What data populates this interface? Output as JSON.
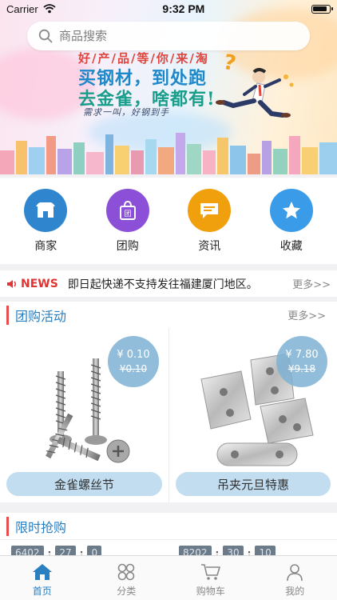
{
  "status": {
    "carrier": "Carrier",
    "time": "9:32 PM"
  },
  "search": {
    "placeholder": "商品搜索"
  },
  "banner": {
    "tagline_top": "好/产/品/等/你/来/淘",
    "line1": "买钢材，到处跑",
    "line2": "去金雀，啥都有!",
    "line3": "需求一叫，好钢到手"
  },
  "quick_nav": [
    {
      "label": "商家",
      "icon": "shop-icon",
      "color": "#2f86cf"
    },
    {
      "label": "团购",
      "icon": "shopping-bag-icon",
      "color": "#8b4fd8"
    },
    {
      "label": "资讯",
      "icon": "message-icon",
      "color": "#f0a00d"
    },
    {
      "label": "收藏",
      "icon": "star-icon",
      "color": "#3a9be8"
    }
  ],
  "news": {
    "title": "NEWS",
    "text": "即日起快递不支持发往福建厦门地区。",
    "more": "更多>>"
  },
  "group_buy": {
    "title": "团购活动",
    "more": "更多>>",
    "products": [
      {
        "price": "¥ 0.10",
        "old_price": "¥0.10",
        "name": "金雀螺丝节"
      },
      {
        "price": "¥ 7.80",
        "old_price": "¥9.18",
        "name": "吊夹元旦特惠"
      }
    ]
  },
  "flash_sale": {
    "title": "限时抢购",
    "timers": [
      [
        "6402",
        "27",
        "0"
      ],
      [
        "8202",
        "30",
        "10"
      ]
    ]
  },
  "tabbar": [
    {
      "label": "首页",
      "icon": "home-icon",
      "active": true
    },
    {
      "label": "分类",
      "icon": "category-icon",
      "active": false
    },
    {
      "label": "购物车",
      "icon": "cart-icon",
      "active": false
    },
    {
      "label": "我的",
      "icon": "profile-icon",
      "active": false
    }
  ],
  "colors": {
    "accent": "#2a7fc0",
    "news_red": "#e03434",
    "section_bar": "#e84e4e"
  }
}
